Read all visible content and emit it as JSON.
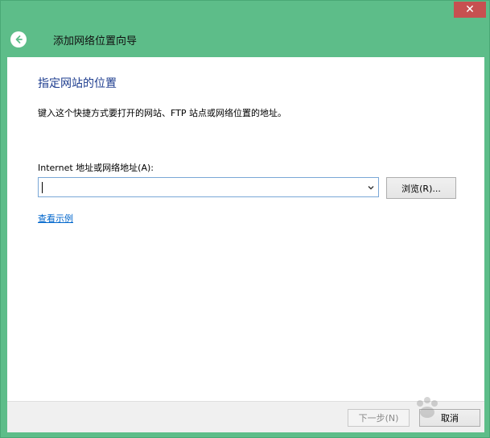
{
  "window": {
    "close_glyph": "✕",
    "title": "添加网络位置向导"
  },
  "page": {
    "heading": "指定网站的位置",
    "description": "键入这个快捷方式要打开的网站、FTP 站点或网络位置的地址。",
    "address_label": "Internet 地址或网络地址(A):",
    "address_value": "",
    "browse_label": "浏览(R)...",
    "example_link": "查看示例"
  },
  "footer": {
    "next_label": "下一步(N)",
    "cancel_label": "取消"
  },
  "colors": {
    "chrome": "#5dbd89",
    "heading": "#1e3d8f",
    "link": "#0066cc",
    "close": "#c75050"
  },
  "icons": {
    "back": "back-arrow-icon",
    "dropdown": "chevron-down-icon",
    "close": "close-icon"
  }
}
